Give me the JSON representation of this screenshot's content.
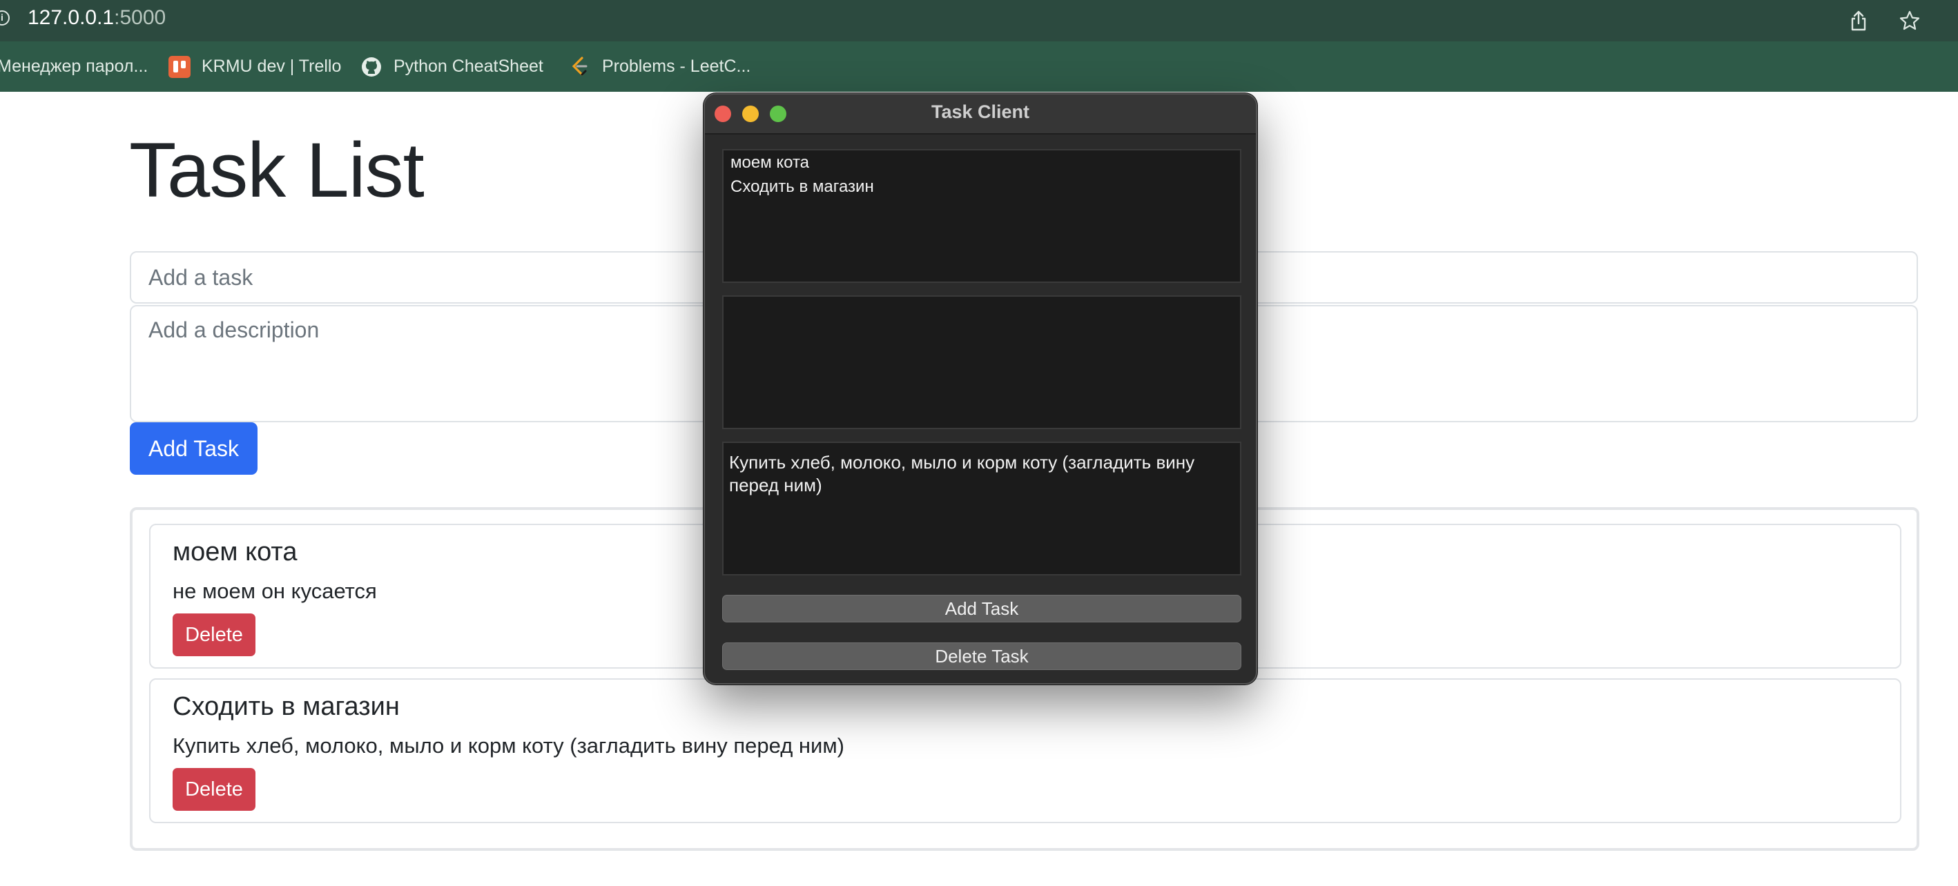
{
  "browser": {
    "url_host": "127.0.0.1",
    "url_port": ":5000",
    "bookmarks": [
      {
        "label": "Менеджер парол...",
        "icon": "none"
      },
      {
        "label": "KRMU dev | Trello",
        "icon": "trello-icon"
      },
      {
        "label": "Python CheatSheet",
        "icon": "github-icon"
      },
      {
        "label": "Problems - LeetC...",
        "icon": "leetcode-icon"
      }
    ]
  },
  "web": {
    "title": "Task List",
    "task_placeholder": "Add a task",
    "description_placeholder": "Add a description",
    "add_button": "Add Task",
    "tasks": [
      {
        "title": "моем кота",
        "description": "не моем он кусается",
        "delete_label": "Delete"
      },
      {
        "title": "Сходить в магазин",
        "description": "Купить хлеб, молоко, мыло и корм коту (загладить вину перед ним)",
        "delete_label": "Delete"
      }
    ]
  },
  "client_window": {
    "title": "Task Client",
    "list_items": [
      "моем кота",
      "Сходить в магазин"
    ],
    "title_entry_value": "",
    "description_value": "Купить хлеб, молоко, мыло и корм коту (загладить вину перед ним)",
    "add_button": "Add Task",
    "delete_button": "Delete Task",
    "traffic_light_colors": {
      "close": "#ee5e56",
      "minimize": "#f5bb2f",
      "maximize": "#5fc34a"
    }
  },
  "colors": {
    "browser_url_bar": "#2c4a3f",
    "browser_bookmarks_bar": "#2e5a48",
    "primary_button": "#2d6bf2",
    "danger_button": "#d0404d"
  }
}
